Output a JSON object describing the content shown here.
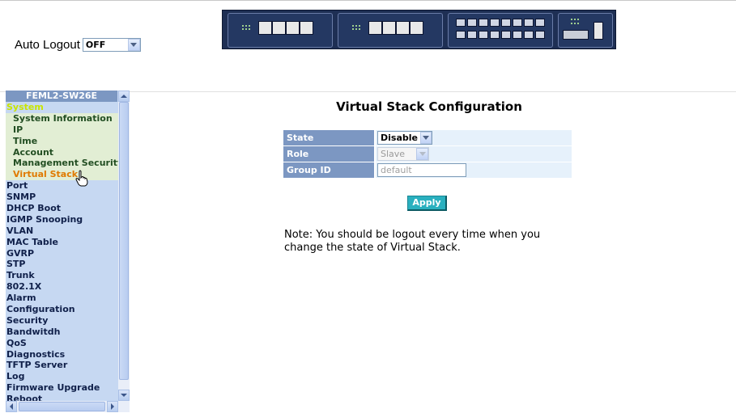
{
  "auto_logout": {
    "label": "Auto Logout",
    "value": "OFF"
  },
  "sidebar": {
    "title": "FEML2-SW26E",
    "items": [
      {
        "label": "System",
        "kind": "system"
      },
      {
        "label": "System Information",
        "kind": "sub"
      },
      {
        "label": "IP",
        "kind": "sub"
      },
      {
        "label": "Time",
        "kind": "sub"
      },
      {
        "label": "Account",
        "kind": "sub"
      },
      {
        "label": "Management Security",
        "kind": "sub"
      },
      {
        "label": "Virtual Stack",
        "kind": "sub-active"
      },
      {
        "label": "Port",
        "kind": "top"
      },
      {
        "label": "SNMP",
        "kind": "top"
      },
      {
        "label": "DHCP Boot",
        "kind": "top"
      },
      {
        "label": "IGMP Snooping",
        "kind": "top"
      },
      {
        "label": "VLAN",
        "kind": "top"
      },
      {
        "label": "MAC Table",
        "kind": "top"
      },
      {
        "label": "GVRP",
        "kind": "top"
      },
      {
        "label": "STP",
        "kind": "top"
      },
      {
        "label": "Trunk",
        "kind": "top"
      },
      {
        "label": "802.1X",
        "kind": "top"
      },
      {
        "label": "Alarm",
        "kind": "top"
      },
      {
        "label": "Configuration",
        "kind": "top"
      },
      {
        "label": "Security",
        "kind": "top"
      },
      {
        "label": "Bandwitdh",
        "kind": "top"
      },
      {
        "label": "QoS",
        "kind": "top"
      },
      {
        "label": "Diagnostics",
        "kind": "top"
      },
      {
        "label": "TFTP Server",
        "kind": "top"
      },
      {
        "label": "Log",
        "kind": "top"
      },
      {
        "label": "Firmware Upgrade",
        "kind": "top"
      },
      {
        "label": "Reboot",
        "kind": "top"
      }
    ]
  },
  "main": {
    "title": "Virtual Stack Configuration",
    "rows": {
      "state": {
        "label": "State",
        "value": "Disable"
      },
      "role": {
        "label": "Role",
        "value": "Slave"
      },
      "group_id": {
        "label": "Group ID",
        "value": "default"
      }
    },
    "apply_label": "Apply",
    "note": "Note: You should be logout every time when you change the state of Virtual Stack."
  },
  "colors": {
    "sidebar_bg": "#c6d8f2",
    "header_blue": "#7c97c2",
    "apply_teal": "#2ab0bf",
    "active_item": "#e07a00",
    "system_item": "#c8e400"
  }
}
